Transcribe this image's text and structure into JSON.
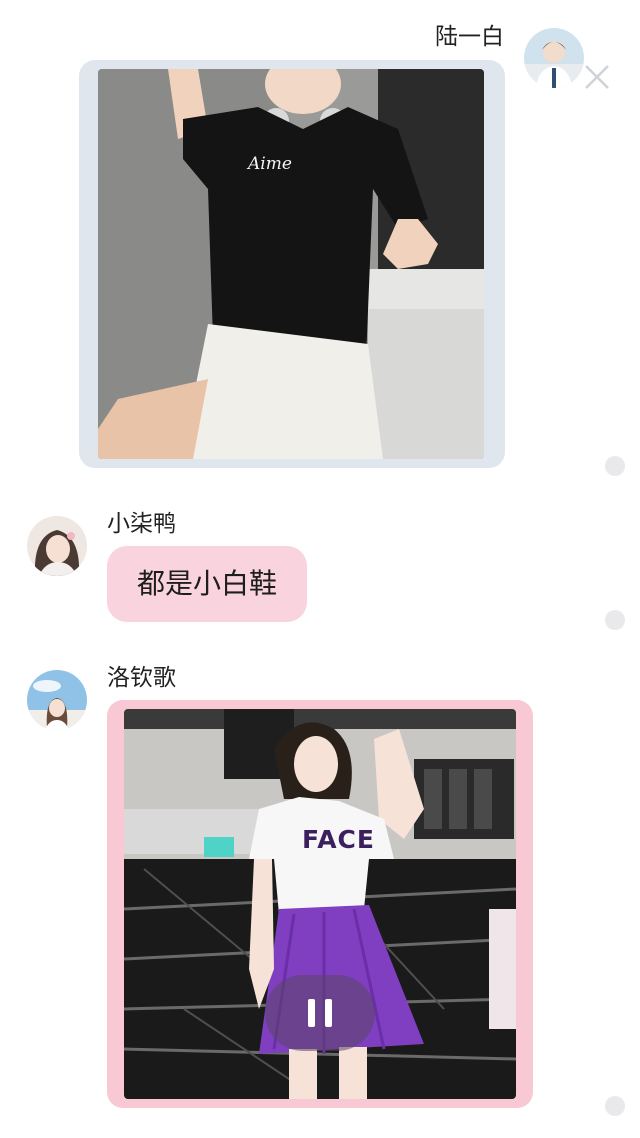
{
  "messages": [
    {
      "sender": "陆一白",
      "type": "image",
      "image_label": "Aime",
      "avatar_icon": "boy-portrait-avatar",
      "side": "right",
      "border_color": "#dfe6ee"
    },
    {
      "sender": "小柒鸭",
      "type": "text",
      "text": "都是小白鞋",
      "avatar_icon": "girl-portrait-avatar",
      "side": "left",
      "bubble_color": "#f9d3dd"
    },
    {
      "sender": "洛钦歌",
      "type": "image",
      "image_label": "FACE",
      "avatar_icon": "girl-sky-avatar",
      "side": "left",
      "border_color": "#f8c8d4"
    }
  ],
  "controls": {
    "close_icon": "close-icon",
    "pause_icon": "pause-icon"
  },
  "colors": {
    "pink_bubble": "#f9d3dd",
    "pink_frame": "#f8c8d4",
    "light_frame": "#dfe6ee",
    "read_dot": "#e9e9ec"
  }
}
